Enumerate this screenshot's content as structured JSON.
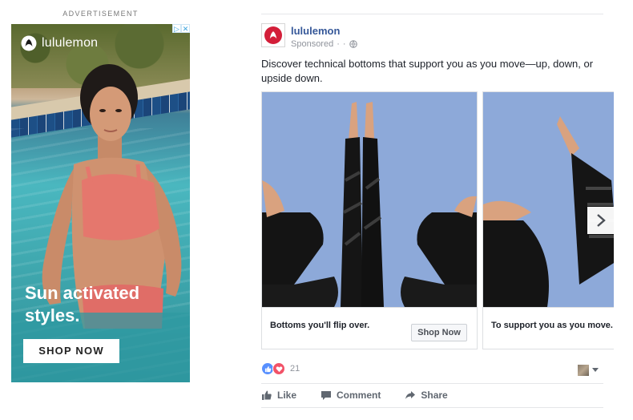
{
  "banner_ad": {
    "ad_label": "ADVERTISEMENT",
    "brand_name": "lululemon",
    "headline": "Sun activated styles.",
    "cta_label": "SHOP NOW",
    "adchoices_icons": [
      "adchoices-icon",
      "close-icon"
    ],
    "colors": {
      "text": "#ffffff",
      "cta_bg": "#ffffff",
      "cta_text": "#222222"
    }
  },
  "post": {
    "page_name": "lululemon",
    "sponsored_label": "Sponsored",
    "post_text": "Discover technical bottoms that support you as you move—up, down, or upside down.",
    "carousel": [
      {
        "caption": "Bottoms you'll flip over.",
        "cta_label": "Shop Now"
      },
      {
        "caption": "To support you as you move."
      }
    ],
    "reaction_count": "21",
    "actions": [
      {
        "label": "Like",
        "icon": "thumbs-up-icon"
      },
      {
        "label": "Comment",
        "icon": "comment-icon"
      },
      {
        "label": "Share",
        "icon": "share-icon"
      }
    ],
    "colors": {
      "link": "#365899",
      "muted": "#90949c",
      "brand_red": "#d31e39",
      "image_bg": "#8da9d9"
    }
  }
}
